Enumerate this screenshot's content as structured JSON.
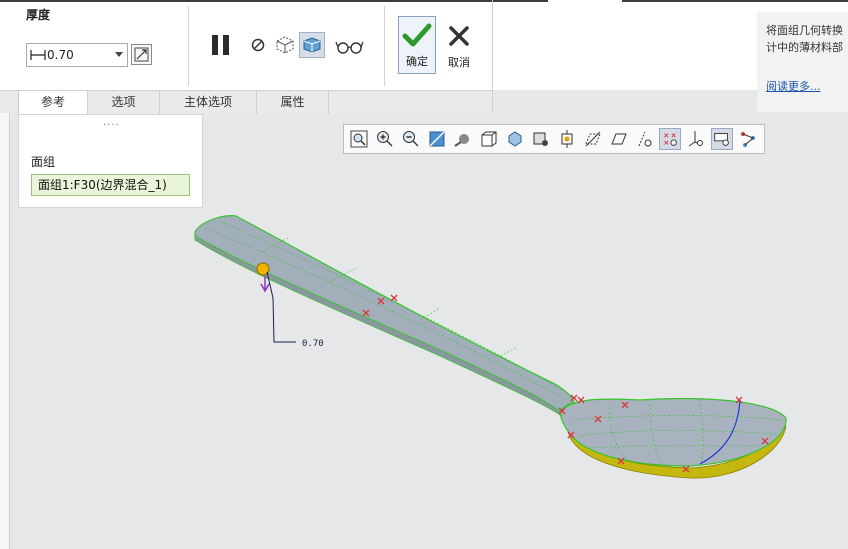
{
  "ribbon": {
    "thickness_label": "厚度",
    "thickness_value": "0.70",
    "ok_label": "确定",
    "cancel_label": "取消"
  },
  "help": {
    "lines": [
      "将面组几何转换",
      "计中的薄材料部"
    ],
    "link": "阅读更多..."
  },
  "tabs": [
    {
      "label": "参考",
      "active": true
    },
    {
      "label": "选项",
      "active": false
    },
    {
      "label": "主体选项",
      "active": false
    },
    {
      "label": "属性",
      "active": false
    }
  ],
  "ref_panel": {
    "grip": "....",
    "label": "面组",
    "value": "面组1:F30(边界混合_1)"
  },
  "viewport": {
    "dimension_text": "0.70"
  },
  "colors": {
    "surface": "#a7b2be",
    "edge_green": "#37c42c",
    "bottom_yellow": "#c8b80a",
    "marker_red": "#d9363e",
    "ok_green": "#2e9a2e"
  },
  "icons": {
    "pause": "pause-icon",
    "stop": "no-preview-icon",
    "preview": "preview-icon",
    "verify": "verify-icon",
    "glasses": "glasses-icon"
  }
}
